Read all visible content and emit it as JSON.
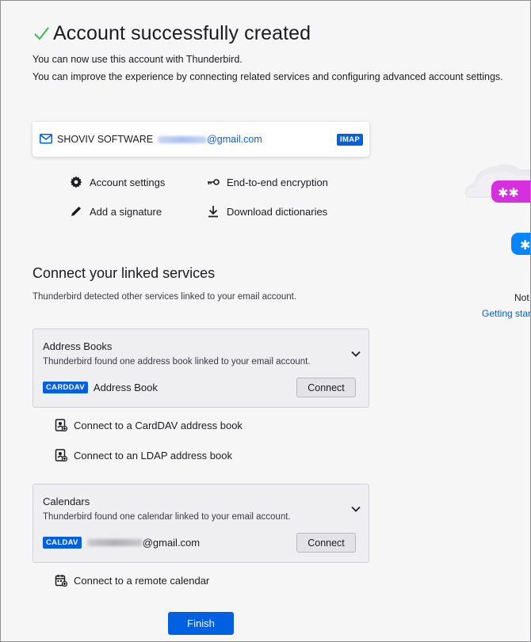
{
  "header": {
    "title": "Account successfully created",
    "line1": "You can now use this account with Thunderbird.",
    "line2": "You can improve the experience by connecting related services and configuring advanced account settings."
  },
  "account": {
    "name": "SHOVIV SOFTWARE",
    "email_suffix": "@gmail.com",
    "protocol": "IMAP"
  },
  "actions": {
    "account_settings": "Account settings",
    "e2e": "End-to-end encryption",
    "signature": "Add a signature",
    "dictionaries": "Download dictionaries"
  },
  "linked": {
    "title": "Connect your linked services",
    "subtitle": "Thunderbird detected other services linked to your email account."
  },
  "address_books": {
    "title": "Address Books",
    "desc": "Thunderbird found one address book linked to your email account.",
    "badge": "CARDDAV",
    "item": "Address Book",
    "connect": "Connect",
    "carddav_link": "Connect to a CardDAV address book",
    "ldap_link": "Connect to an LDAP address book"
  },
  "calendars": {
    "title": "Calendars",
    "desc": "Thunderbird found one calendar linked to your email account.",
    "badge": "CALDAV",
    "item_suffix": "@gmail.com",
    "connect": "Connect",
    "remote_link": "Connect to a remote calendar"
  },
  "finish": "Finish",
  "side": {
    "text_fragment": "Not",
    "link_fragment": "Getting star"
  },
  "colors": {
    "accent": "#0060df",
    "success": "#2ac3a2",
    "purple": "#d62fe0"
  }
}
